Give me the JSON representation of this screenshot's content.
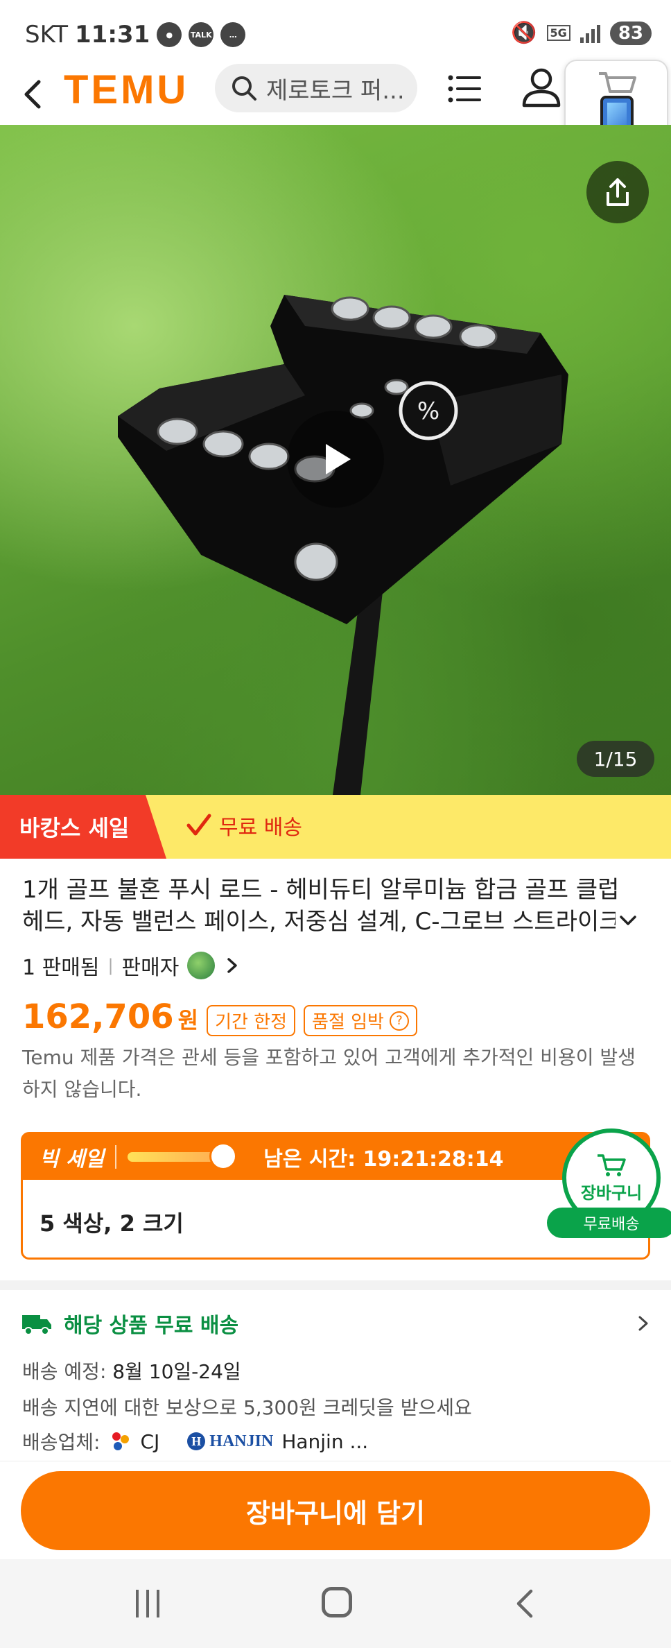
{
  "status_bar": {
    "carrier": "SKT",
    "time": "11:31",
    "talk_badge": "TALK",
    "network": "5G",
    "battery": "83"
  },
  "header": {
    "logo": "TEMU",
    "search_placeholder": "제로토크 퍼..."
  },
  "gallery": {
    "counter": "1/15"
  },
  "promo": {
    "sale_label": "바캉스 세일",
    "free_shipping": "무료 배송"
  },
  "product": {
    "title": "1개 골프 불혼 푸시 로드 - 헤비듀티 알루미늄 합금 골프 클럽 헤드, 자동 밸런스 페이스, 저중심 설계, C-그로브 스트라이크 서페이스",
    "sold": "1 판매됨",
    "seller_label": "판매자",
    "price": "162,706",
    "price_unit": "원",
    "badge_limited": "기간 한정",
    "badge_soldout": "품절 임박",
    "tax_note": "Temu 제품 가격은 관세 등을 포함하고 있어 고객에게 추가적인 비용이 발생하지 않습니다."
  },
  "big_sale": {
    "label": "빅 세일",
    "remaining": "남은 시간: 19:21:28:14",
    "variants": "5 색상, 2 크기",
    "cart_badge": "장바구니",
    "cart_ribbon": "무료배송"
  },
  "shipping": {
    "title": "해당 상품 무료 배송",
    "eta_label": "배송 예정:",
    "eta_value": "8월 10일-24일",
    "delay_note": "배송 지연에 대한 보상으로 5,300원 크레딧을 받으세요",
    "carrier_label": "배송업체:",
    "carrier_cj": "CJ",
    "carrier_hanjin_logo": "HANJIN",
    "carrier_hanjin": "Hanjin ..."
  },
  "actions": {
    "add_to_cart": "장바구니에 담기"
  },
  "colors": {
    "accent": "#fb7701",
    "sale_red": "#f23b28",
    "banner_yellow": "#fde968",
    "ship_green": "#0a8f42"
  }
}
